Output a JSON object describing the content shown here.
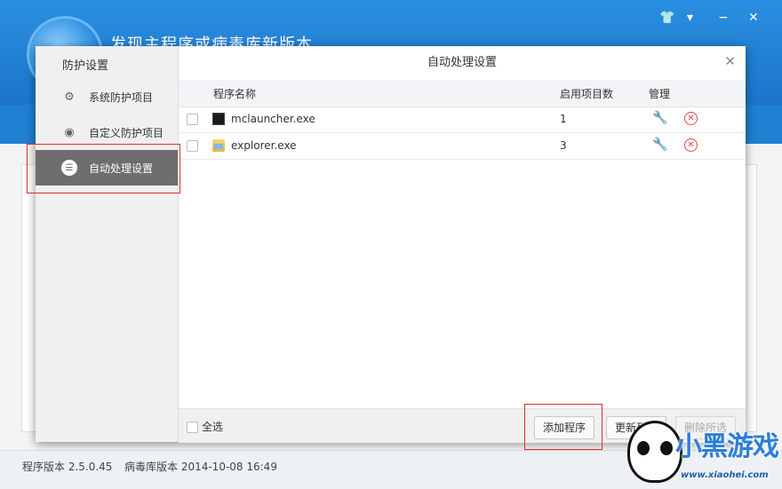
{
  "background_app": {
    "title": "发现主程序或病毒库新版本",
    "controls": {
      "skin": "👕",
      "menu": "▾",
      "minimize": "−",
      "close": "✕"
    },
    "footer": {
      "program_version": "程序版本 2.5.0.45",
      "virus_db_version": "病毒库版本 2014-10-08 16:49"
    }
  },
  "dialog": {
    "sidebar": {
      "title": "防护设置",
      "items": [
        {
          "label": "系统防护项目",
          "icon": "gear-icon",
          "glyph": "⚙"
        },
        {
          "label": "自定义防护项目",
          "icon": "shield-icon",
          "glyph": "◉"
        },
        {
          "label": "自动处理设置",
          "icon": "list-icon",
          "glyph": "☰",
          "active": true
        }
      ]
    },
    "title": "自动处理设置",
    "close_glyph": "✕",
    "table": {
      "columns": [
        "程序名称",
        "启用项目数",
        "管理"
      ],
      "rows": [
        {
          "name": "mclauncher.exe",
          "count": "1",
          "icon": "app-icon-dark"
        },
        {
          "name": "explorer.exe",
          "count": "3",
          "icon": "folder-icon"
        }
      ],
      "edit_glyph": "🔧",
      "delete_glyph": "✕"
    },
    "footer": {
      "select_all": "全选",
      "add_button": "添加程序",
      "refresh_button": "更新列表",
      "delete_selected_button": "删除所选"
    }
  },
  "watermark": {
    "text": "小黑游戏",
    "url": "www.xiaohei.com"
  },
  "colors": {
    "accent_blue": "#1f7fd0",
    "active_sidebar": "#6e6e6e",
    "highlight_red": "#d43030",
    "delete_red": "#e04848",
    "link_blue": "#2b7ed8"
  }
}
